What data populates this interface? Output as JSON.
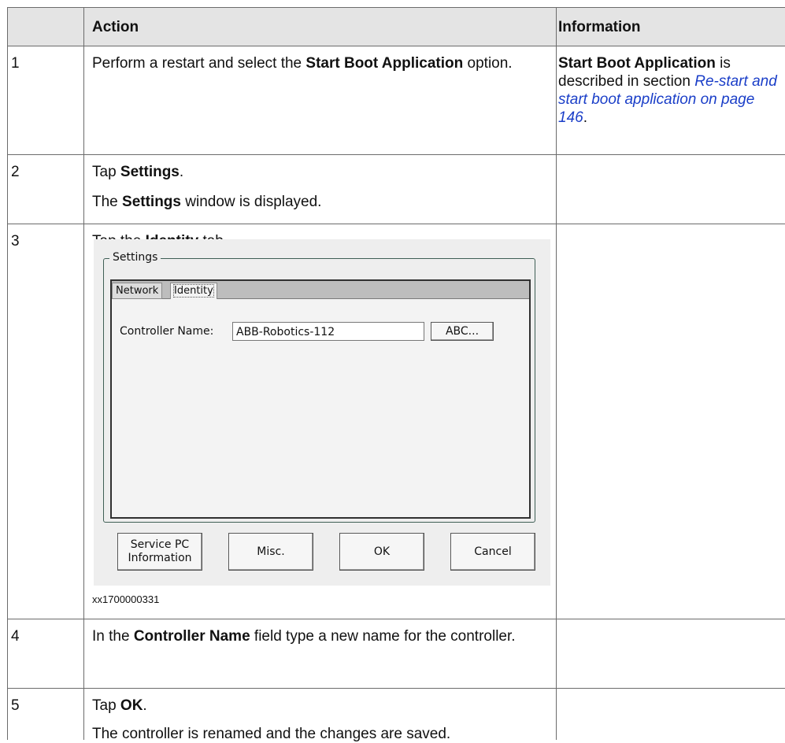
{
  "table": {
    "headers": {
      "col_num": "",
      "action": "Action",
      "information": "Information"
    },
    "rows": [
      {
        "num": "1",
        "action_pre": "Perform a restart and select the ",
        "action_bold": "Start Boot Application",
        "action_post": " option.",
        "info_bold": "Start Boot Application",
        "info_mid": " is described in section ",
        "info_link": "Re-start and start boot application on page 146",
        "info_end": "."
      },
      {
        "num": "2",
        "line1_pre": "Tap ",
        "line1_bold": "Settings",
        "line1_post": ".",
        "line2_pre": "The ",
        "line2_bold": "Settings",
        "line2_post": " window is displayed."
      },
      {
        "num": "3",
        "line1_pre": "Tap the ",
        "line1_bold": "Identity",
        "line1_post": " tab.",
        "caption": "xx1700000331"
      },
      {
        "num": "4",
        "pre": "In the ",
        "bold": "Controller Name",
        "post": " field type a new name for the controller."
      },
      {
        "num": "5",
        "line1_pre": "Tap ",
        "line1_bold": "OK",
        "line1_post": ".",
        "line2": "The controller is renamed and the changes are saved."
      }
    ]
  },
  "dialog": {
    "group_title": "Settings",
    "tabs": [
      "Network",
      "Identity"
    ],
    "field_label": "Controller Name:",
    "field_value": "ABB-Robotics-112",
    "abc_button": "ABC...",
    "buttons": {
      "service": "Service PC Information",
      "misc": "Misc.",
      "ok": "OK",
      "cancel": "Cancel"
    }
  }
}
